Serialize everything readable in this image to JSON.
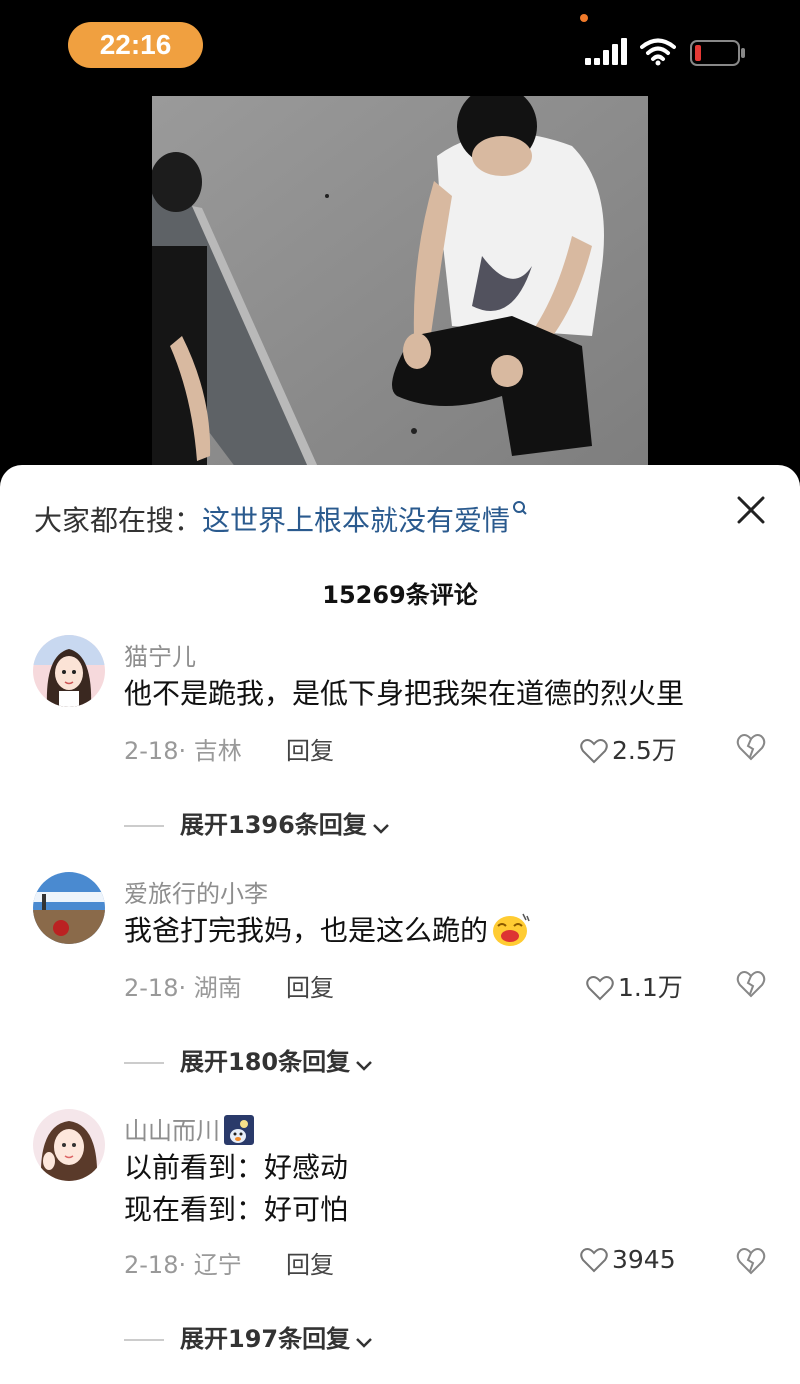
{
  "status": {
    "time": "22:16"
  },
  "search": {
    "prefix": "大家都在搜：",
    "query": "这世界上根本就没有爱情"
  },
  "comments_header": {
    "count_label": "15269条评论"
  },
  "comments": [
    {
      "username": "猫宁儿",
      "text": "他不是跪我，是低下身把我架在道德的烈火里",
      "date": "2-18",
      "location": "吉林",
      "reply_label": "回复",
      "likes": "2.5万",
      "expand_label": "展开1396条回复"
    },
    {
      "username": "爱旅行的小李",
      "text": "我爸打完我妈，也是这么跪的",
      "date": "2-18",
      "location": "湖南",
      "reply_label": "回复",
      "likes": "1.1万",
      "expand_label": "展开180条回复"
    },
    {
      "username": "山山而川",
      "text_line1": "以前看到：好感动",
      "text_line2": "现在看到：好可怕",
      "date": "2-18",
      "location": "辽宁",
      "reply_label": "回复",
      "likes": "3945",
      "expand_label": "展开197条回复"
    }
  ],
  "colors": {
    "time_pill": "#f0a040",
    "search_link": "#2a5a8e",
    "battery_low": "#e53935"
  }
}
